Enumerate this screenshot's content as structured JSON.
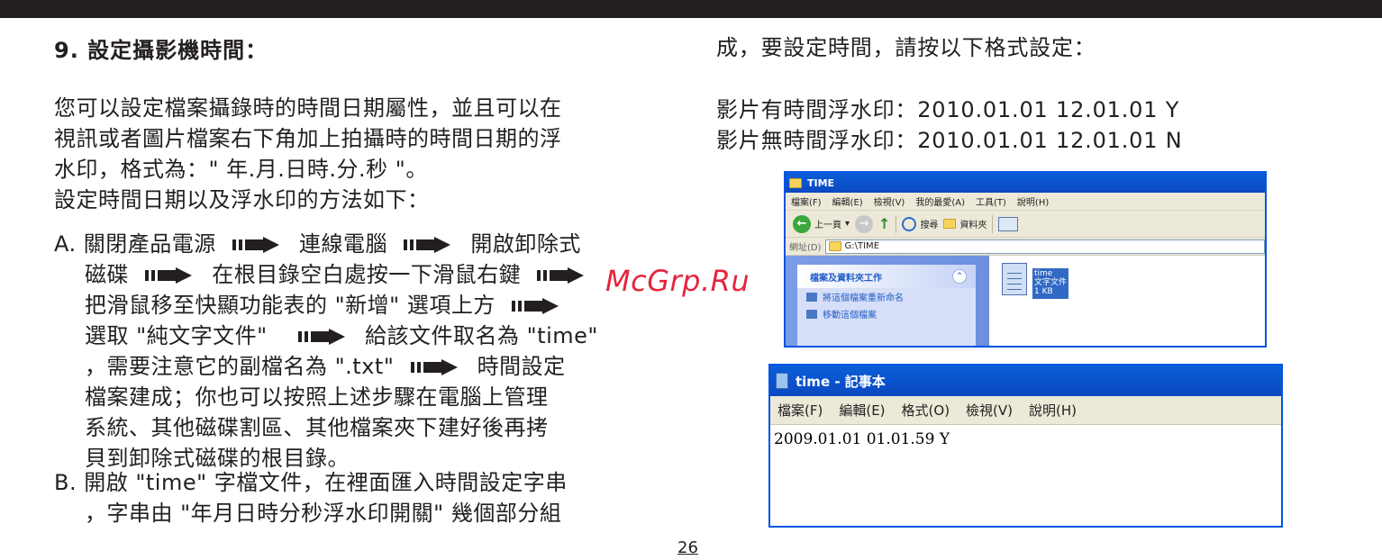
{
  "section_title": "9. 設定攝影機時間：",
  "intro": {
    "line1": "您可以設定檔案攝錄時的時間日期屬性，並且可以在",
    "line2": "視訊或者圖片檔案右下角加上拍攝時的時間日期的浮",
    "line3": "水印，格式為：\" 年.月.日時.分.秒 \"。",
    "line4": "設定時間日期以及浮水印的方法如下："
  },
  "step_a": {
    "l1_a": "A. 關閉產品電源",
    "l1_b": "連線電腦",
    "l1_c": "開啟卸除式",
    "l2_a": "磁碟",
    "l2_b": "在根目錄空白處按一下滑鼠右鍵",
    "l3_a": "把滑鼠移至快顯功能表的 \"新增\" 選項上方",
    "l4_a": "選取 \"純文字文件\"",
    "l4_b": "給該文件取名為 \"time\"",
    "l5_a": "，需要注意它的副檔名為 \".txt\"",
    "l5_b": "時間設定",
    "l6": "檔案建成；你也可以按照上述步驟在電腦上管理",
    "l7": "系統、其他磁碟割區、其他檔案夾下建好後再拷",
    "l8": "貝到卸除式磁碟的根目錄。"
  },
  "step_b": {
    "l1": "B. 開啟 \"time\" 字檔文件，在裡面匯入時間設定字串",
    "l2": "，字串由 \"年月日時分秒浮水印開關\" 幾個部分組"
  },
  "right": {
    "intro": "成，要設定時間，請按以下格式設定：",
    "wm_yes": "影片有時間浮水印：2010.01.01 12.01.01 Y",
    "wm_no": "影片無時間浮水印：2010.01.01 12.01.01 N"
  },
  "watermark": "McGrp.Ru",
  "explorer": {
    "title": "TIME",
    "menu": [
      "檔案(F)",
      "編輯(E)",
      "檢視(V)",
      "我的最愛(A)",
      "工具(T)",
      "說明(H)"
    ],
    "back": "上一頁",
    "search": "搜尋",
    "folders": "資料夾",
    "address_label": "網址(D)",
    "address": "G:\\TIME",
    "task_title": "檔案及資料夾工作",
    "task_items": [
      "將這個檔案重新命名",
      "移動這個檔案"
    ],
    "file_name": "time",
    "file_type": "文字文件",
    "file_size": "1 KB"
  },
  "notepad": {
    "title": "time - 記事本",
    "menu": [
      "檔案(F)",
      "編輯(E)",
      "格式(O)",
      "檢視(V)",
      "說明(H)"
    ],
    "content": "2009.01.01 01.01.59 Y"
  },
  "page_number": "26"
}
